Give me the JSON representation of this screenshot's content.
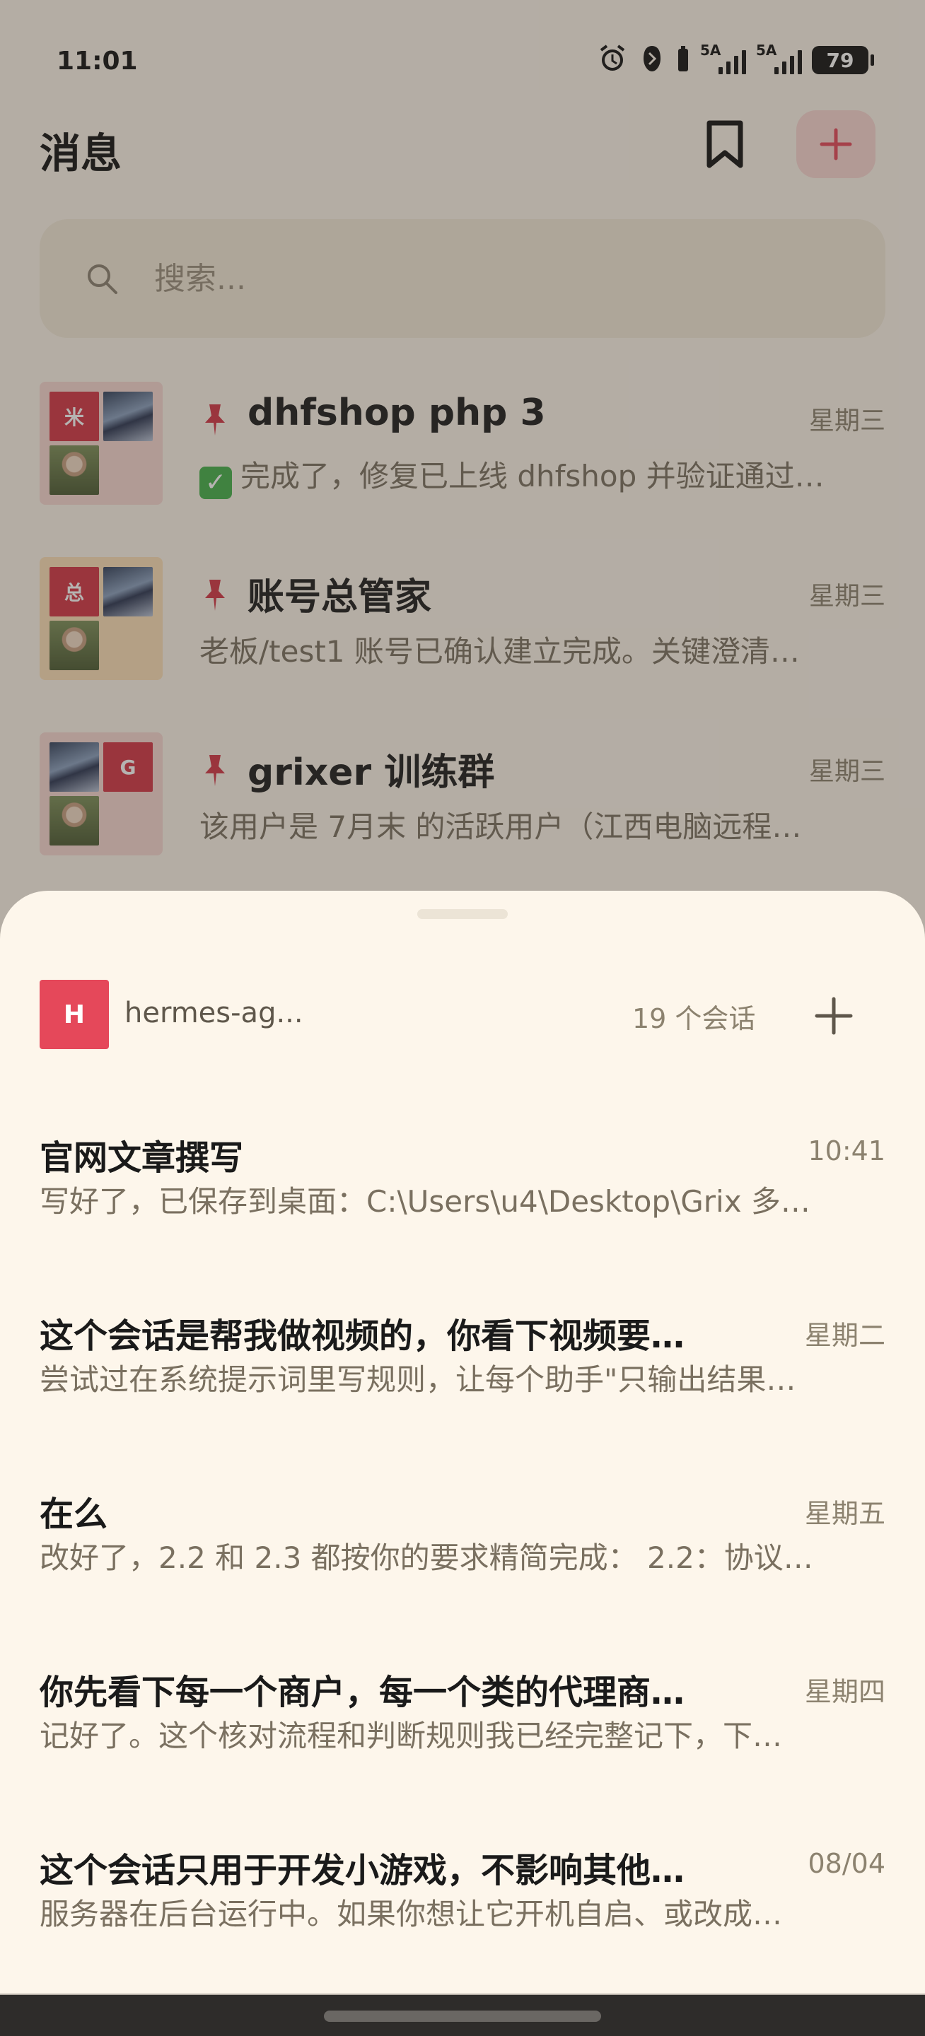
{
  "status_bar": {
    "time": "11:01",
    "signal1_label": "5A",
    "signal2_label": "5A",
    "battery": "79"
  },
  "header": {
    "title": "消息"
  },
  "search": {
    "placeholder": "搜索..."
  },
  "conversations": [
    {
      "name": "dhfshop php 3",
      "date": "星期三",
      "preview": "完成了，修复已上线 dhfshop 并验证通过…",
      "avatar_letter": "米",
      "pinned": true
    },
    {
      "name": "账号总管家",
      "date": "星期三",
      "preview": "老板/test1 账号已确认建立完成。关键澄清…",
      "avatar_letter": "总",
      "pinned": true
    },
    {
      "name": "grixer 训练群",
      "date": "星期三",
      "preview": "该用户是 7月末 的活跃用户（江西电脑远程…",
      "avatar_letter": "G",
      "pinned": true
    }
  ],
  "sheet": {
    "agent_initial": "H",
    "agent_name": "hermes-ag...",
    "session_count": "19 个会话",
    "sessions": [
      {
        "title": "官网文章撰写",
        "time": "10:41",
        "preview": "写好了，已保存到桌面：C:\\Users\\u4\\Desktop\\Grix 多…"
      },
      {
        "title": "这个会话是帮我做视频的，你看下视频要…",
        "time": "星期二",
        "preview": "尝试过在系统提示词里写规则，让每个助手\"只输出结果…"
      },
      {
        "title": "在么",
        "time": "星期五",
        "preview": "改好了，2.2 和 2.3 都按你的要求精简完成： 2.2：协议…"
      },
      {
        "title": "你先看下每一个商户，每一个类的代理商…",
        "time": "星期四",
        "preview": "记好了。这个核对流程和判断规则我已经完整记下，下…"
      },
      {
        "title": "这个会话只用于开发小游戏，不影响其他…",
        "time": "08/04",
        "preview": "服务器在后台运行中。如果你想让它开机自启、或改成…"
      }
    ]
  },
  "colors": {
    "accent": "#e5485a",
    "background": "#fdf6eb",
    "pin": "#d33444"
  }
}
